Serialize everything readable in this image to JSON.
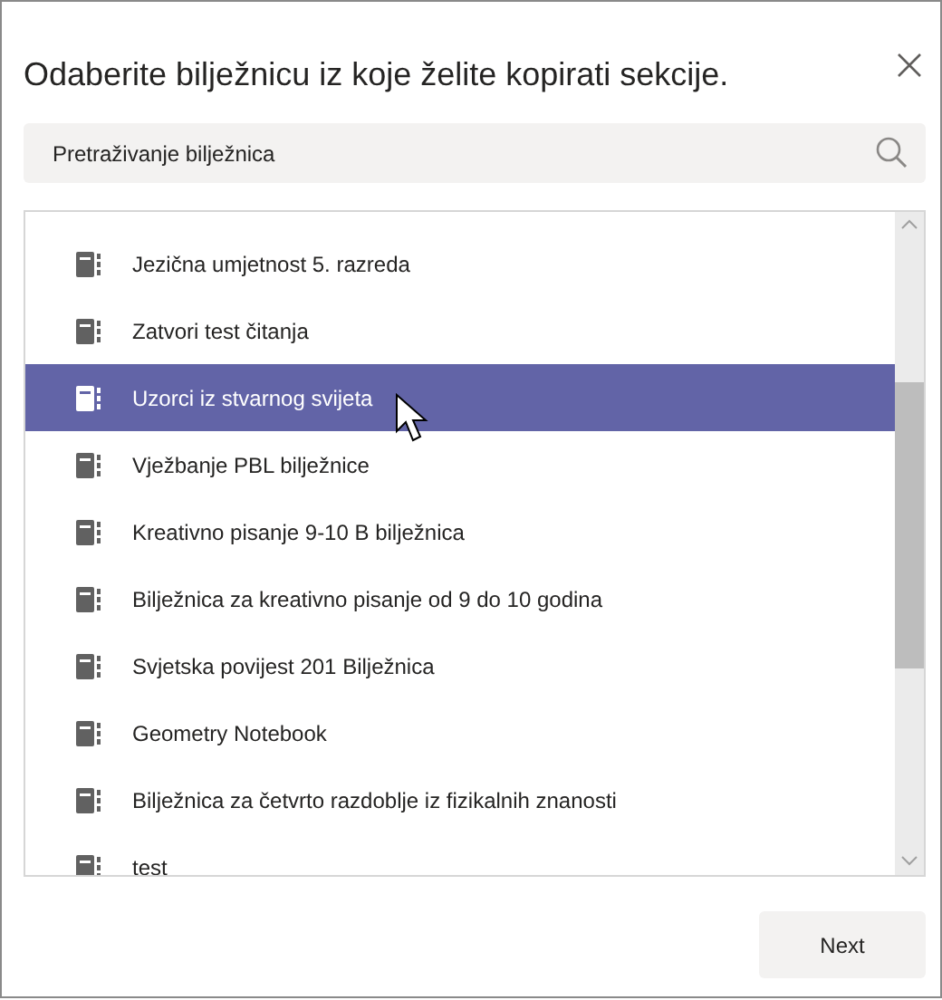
{
  "dialog": {
    "title": "Odaberite bilježnicu iz koje želite kopirati sekcije."
  },
  "search": {
    "placeholder": "Pretraživanje bilježnica"
  },
  "notebooks": [
    {
      "name": "Jezična umjetnost 5. razreda",
      "selected": false
    },
    {
      "name": "Zatvori test čitanja",
      "selected": false
    },
    {
      "name": "Uzorci iz stvarnog svijeta",
      "selected": true
    },
    {
      "name": "Vježbanje PBL bilježnice",
      "selected": false
    },
    {
      "name": "Kreativno pisanje 9-10 B bilježnica",
      "selected": false
    },
    {
      "name": "Bilježnica za kreativno pisanje od 9 do 10 godina",
      "selected": false
    },
    {
      "name": "Svjetska povijest 201   Bilježnica",
      "selected": false
    },
    {
      "name": "Geometry Notebook",
      "selected": false
    },
    {
      "name": "Bilježnica za četvrto razdoblje iz fizikalnih znanosti",
      "selected": false
    },
    {
      "name": "test",
      "selected": false
    }
  ],
  "buttons": {
    "next": "Next"
  }
}
